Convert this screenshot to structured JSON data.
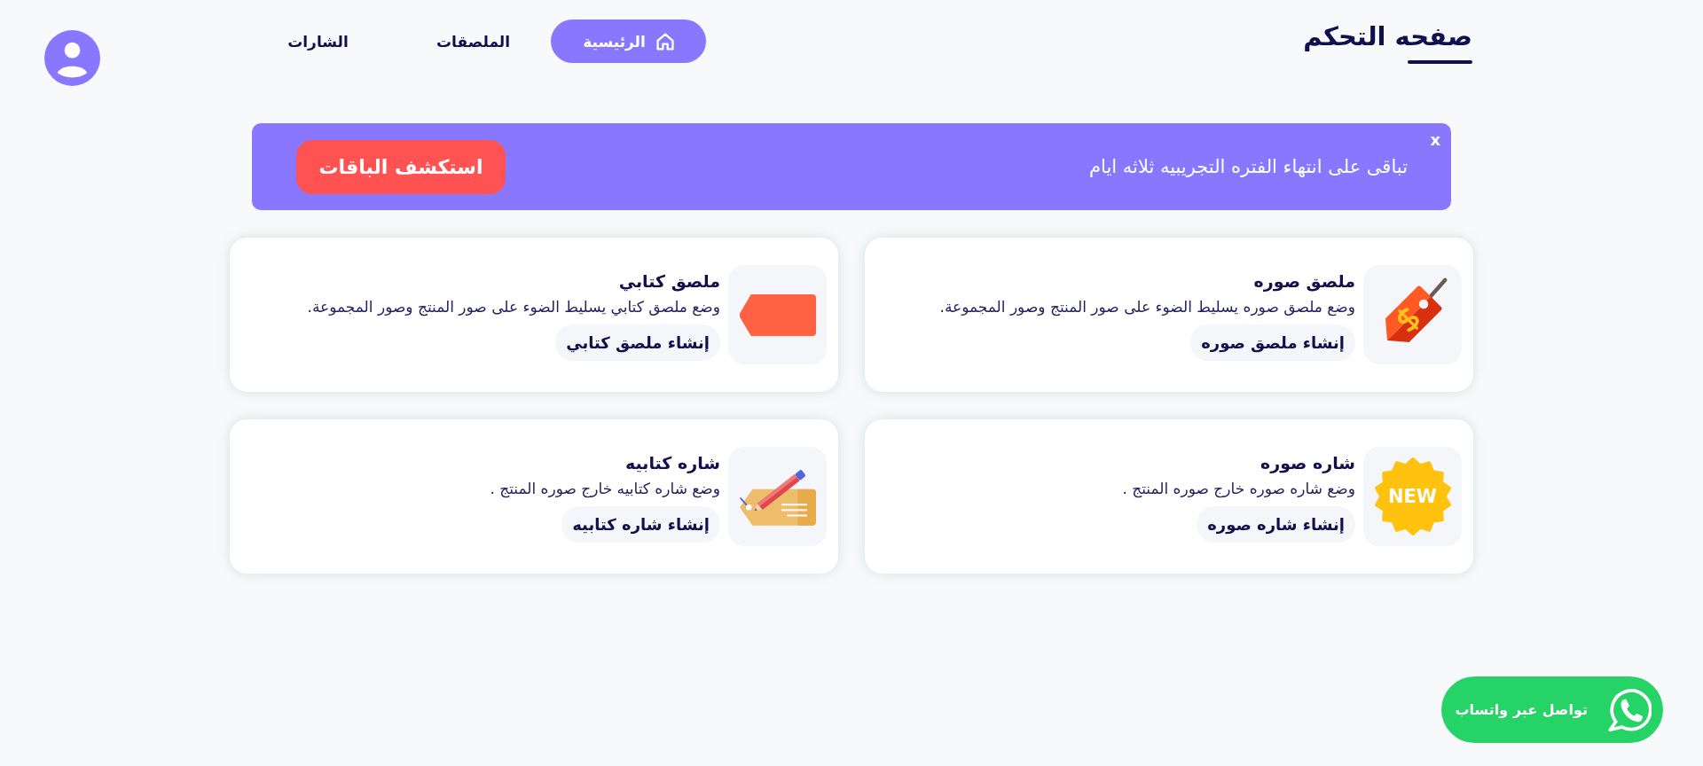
{
  "header": {
    "title": "صفحه التحكم",
    "nav": [
      {
        "label": "الرئيسية",
        "kind": "with-icon",
        "selected": true
      },
      {
        "label": "الملصقات",
        "kind": "plain",
        "selected": false
      },
      {
        "label": "الشارات",
        "kind": "plain",
        "selected": false
      }
    ]
  },
  "trial_banner": {
    "message": "تباقى على انتهاء الفتره التجريبيه ثلاثه ايام",
    "button": "استكشف الباقات",
    "close": "x"
  },
  "cards": [
    {
      "kind": "price-tag",
      "title": "ملصق صوره",
      "description": "وضع ملصق صوره يسليط الضوء على صور المنتج وصور المجموعة.",
      "button": "إنشاء ملصق صوره"
    },
    {
      "kind": "label",
      "title": "ملصق كتابي",
      "description": "وضع ملصق كتابي يسليط الضوء على صور المنتج وصور المجموعة.",
      "button": "إنشاء ملصق كتابي"
    },
    {
      "kind": "new-badge",
      "badge_text": "NEW",
      "title": "شاره صوره",
      "description": "وضع شاره صوره خارج صوره المنتج .",
      "button": "إنشاء شاره صوره"
    },
    {
      "kind": "pencil-tag",
      "title": "شاره كتابيه",
      "description": "وضع شاره كتابيه خارج صوره المنتج .",
      "button": "إنشاء شاره كتابيه"
    }
  ],
  "whatsapp_button": {
    "label": "تواصل عبر واتساب"
  }
}
